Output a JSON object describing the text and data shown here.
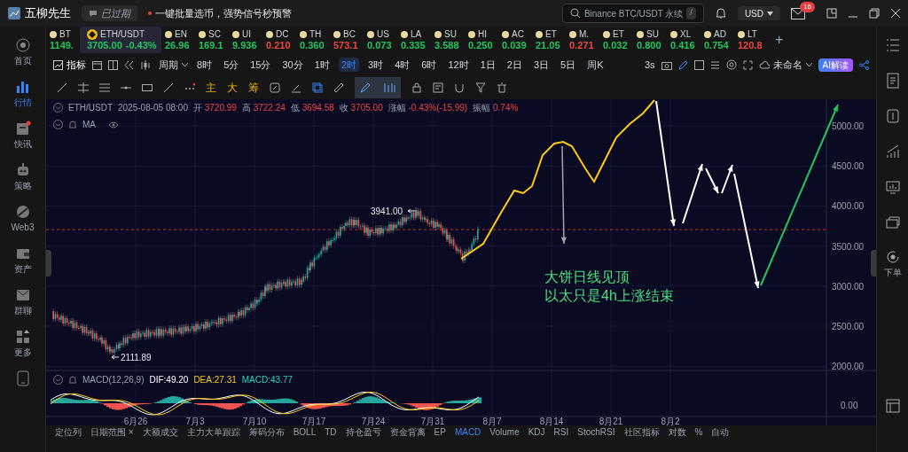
{
  "app": {
    "name": "五柳先生",
    "badge": "已过期",
    "promo": "一键批量选币，强势信号秒预警"
  },
  "search": {
    "placeholder": "Binance BTC/USDT 永续",
    "key": "/"
  },
  "currency": "USD",
  "mail_count": "16",
  "tickers": [
    {
      "symbol": "BT",
      "price": "1149.",
      "color": "#22c55e",
      "selected": false
    },
    {
      "symbol": "ETH/USDT",
      "price": "3705.00",
      "change": "-0.43%",
      "color": "#22c55e",
      "selected": true
    },
    {
      "symbol": "EN",
      "price": "26.96",
      "color": "#22c55e",
      "selected": false
    },
    {
      "symbol": "SC",
      "price": "169.1",
      "color": "#22c55e",
      "selected": false
    },
    {
      "symbol": "UI",
      "price": "9.936",
      "color": "#22c55e",
      "selected": false
    },
    {
      "symbol": "DC",
      "price": "0.210",
      "color": "#ef4444",
      "selected": false
    },
    {
      "symbol": "TH",
      "price": "0.360",
      "color": "#22c55e",
      "selected": false
    },
    {
      "symbol": "BC",
      "price": "573.1",
      "color": "#ef4444",
      "selected": false
    },
    {
      "symbol": "US",
      "price": "0.073",
      "color": "#22c55e",
      "selected": false
    },
    {
      "symbol": "LA",
      "price": "0.335",
      "color": "#22c55e",
      "selected": false
    },
    {
      "symbol": "SU",
      "price": "3.588",
      "color": "#22c55e",
      "selected": false
    },
    {
      "symbol": "HI",
      "price": "0.250",
      "color": "#22c55e",
      "selected": false
    },
    {
      "symbol": "AC",
      "price": "0.039",
      "color": "#22c55e",
      "selected": false
    },
    {
      "symbol": "ET",
      "price": "21.05",
      "color": "#22c55e",
      "selected": false
    },
    {
      "symbol": "M.",
      "price": "0.271",
      "color": "#ef4444",
      "selected": false
    },
    {
      "symbol": "ET",
      "price": "0.032",
      "color": "#22c55e",
      "selected": false
    },
    {
      "symbol": "SU",
      "price": "0.800",
      "color": "#22c55e",
      "selected": false
    },
    {
      "symbol": "XL",
      "price": "0.416",
      "color": "#22c55e",
      "selected": false
    },
    {
      "symbol": "AD",
      "price": "0.754",
      "color": "#22c55e",
      "selected": false
    },
    {
      "symbol": "LT",
      "price": "120.8",
      "color": "#ef4444",
      "selected": false
    }
  ],
  "add_button": "+",
  "sidebar": [
    {
      "label": "首页",
      "selected": false
    },
    {
      "label": "行情",
      "selected": true
    },
    {
      "label": "快讯",
      "selected": false
    },
    {
      "label": "策略",
      "selected": false
    },
    {
      "label": "Web3",
      "selected": false
    },
    {
      "label": "资产",
      "selected": false
    },
    {
      "label": "群聊",
      "selected": false
    },
    {
      "label": "更多",
      "selected": false
    }
  ],
  "toolbar": {
    "indicator": "指标",
    "period": "周期",
    "intervals": [
      {
        "label": "8时",
        "selected": false
      },
      {
        "label": "5分",
        "selected": false
      },
      {
        "label": "15分",
        "selected": false
      },
      {
        "label": "30分",
        "selected": false
      },
      {
        "label": "1时",
        "selected": false
      },
      {
        "label": "2时",
        "selected": true
      },
      {
        "label": "3时",
        "selected": false
      },
      {
        "label": "4时",
        "selected": false
      },
      {
        "label": "6时",
        "selected": false
      },
      {
        "label": "12时",
        "selected": false
      },
      {
        "label": "1日",
        "selected": false
      },
      {
        "label": "2日",
        "selected": false
      },
      {
        "label": "3日",
        "selected": false
      },
      {
        "label": "5日",
        "selected": false
      },
      {
        "label": "周K",
        "selected": false
      }
    ],
    "refresh": "3s",
    "layout_name": "未命名",
    "ai_button": "AI解读"
  },
  "draw_tools": {
    "overlays": [
      "主",
      "大",
      "筹"
    ]
  },
  "chart": {
    "symbol": "ETH/USDT",
    "time": "2025-08-05 08:00",
    "ohlc": [
      {
        "label": "开",
        "value": "3720.99"
      },
      {
        "label": "高",
        "value": "3722.24"
      },
      {
        "label": "低",
        "value": "3694.58"
      },
      {
        "label": "收",
        "value": "3705.00"
      },
      {
        "label": "涨幅",
        "value": "-0.43%(-15.99)"
      },
      {
        "label": "振幅",
        "value": "0.74%"
      }
    ],
    "ma_label": "MA",
    "high_mark": "3941.00",
    "low_mark": "2111.89",
    "price_axis": [
      "5000.00",
      "4500.00",
      "4000.00",
      "3500.00",
      "3000.00",
      "2500.00",
      "2000.00"
    ],
    "time_axis": [
      "6月26",
      "7月3",
      "7月10",
      "7月17",
      "7月24",
      "7月31",
      "8月7",
      "8月14",
      "8月21",
      "8月2"
    ],
    "note_lines": [
      "大饼日线见顶",
      "以太只是4h上涨结束"
    ],
    "macd": {
      "name": "MACD(12,26,9)",
      "dif": "DIF:49.20",
      "dea": "DEA:27.31",
      "macd": "MACD:43.77",
      "zero": "0.00"
    }
  },
  "right_sidebar": {
    "order_label": "下单"
  },
  "bottom_tabs": [
    {
      "label": "定位列",
      "selected": false
    },
    {
      "label": "日期范围 ×",
      "selected": false
    },
    {
      "label": "大额成交",
      "selected": false
    },
    {
      "label": "主力大单跟踪",
      "selected": false
    },
    {
      "label": "筹码分布",
      "selected": false
    },
    {
      "label": "BOLL",
      "selected": false
    },
    {
      "label": "TD",
      "selected": false
    },
    {
      "label": "持仓盈亏",
      "selected": false
    },
    {
      "label": "资金背离",
      "selected": false
    },
    {
      "label": "EP",
      "selected": false
    },
    {
      "label": "MACD",
      "selected": true
    },
    {
      "label": "Volume",
      "selected": false
    },
    {
      "label": "KDJ",
      "selected": false
    },
    {
      "label": "RSI",
      "selected": false
    },
    {
      "label": "StochRSI",
      "selected": false
    },
    {
      "label": "社区指标",
      "selected": false
    },
    {
      "label": "对数",
      "selected": false
    },
    {
      "label": "%",
      "selected": false
    },
    {
      "label": "自动",
      "selected": false
    }
  ]
}
